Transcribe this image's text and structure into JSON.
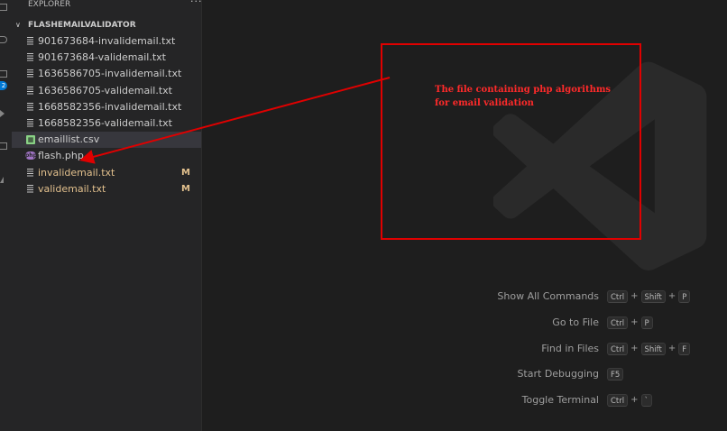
{
  "sidebar": {
    "title": "EXPLORER",
    "more_label": "···",
    "folder": "FLASHEMAILVALIDATOR",
    "files": [
      {
        "name": "901673684-invalidemail.txt",
        "icon": "text-file-icon"
      },
      {
        "name": "901673684-validemail.txt",
        "icon": "text-file-icon"
      },
      {
        "name": "1636586705-invalidemail.txt",
        "icon": "text-file-icon"
      },
      {
        "name": "1636586705-validemail.txt",
        "icon": "text-file-icon"
      },
      {
        "name": "1668582356-invalidemail.txt",
        "icon": "text-file-icon"
      },
      {
        "name": "1668582356-validemail.txt",
        "icon": "text-file-icon"
      },
      {
        "name": "emaillist.csv",
        "icon": "csv-file-icon",
        "selected": true
      },
      {
        "name": "flash.php",
        "icon": "php-file-icon"
      },
      {
        "name": "invalidemail.txt",
        "icon": "text-file-icon",
        "status": "M"
      },
      {
        "name": "validemail.txt",
        "icon": "text-file-icon",
        "status": "M"
      }
    ]
  },
  "activity_bar": {
    "badge": "2"
  },
  "annotation": {
    "text": "The file containing php algorithms for email validation",
    "color": "#e00000"
  },
  "shortcuts": [
    {
      "label": "Show All Commands",
      "keys": [
        "Ctrl",
        "Shift",
        "P"
      ]
    },
    {
      "label": "Go to File",
      "keys": [
        "Ctrl",
        "P"
      ]
    },
    {
      "label": "Find in Files",
      "keys": [
        "Ctrl",
        "Shift",
        "F"
      ]
    },
    {
      "label": "Start Debugging",
      "keys": [
        "F5"
      ]
    },
    {
      "label": "Toggle Terminal",
      "keys": [
        "Ctrl",
        "`"
      ]
    }
  ],
  "colors": {
    "modified": "#e2c08d",
    "selected_row": "#37373d",
    "editor_bg": "#1e1e1e",
    "sidebar_bg": "#252526"
  }
}
